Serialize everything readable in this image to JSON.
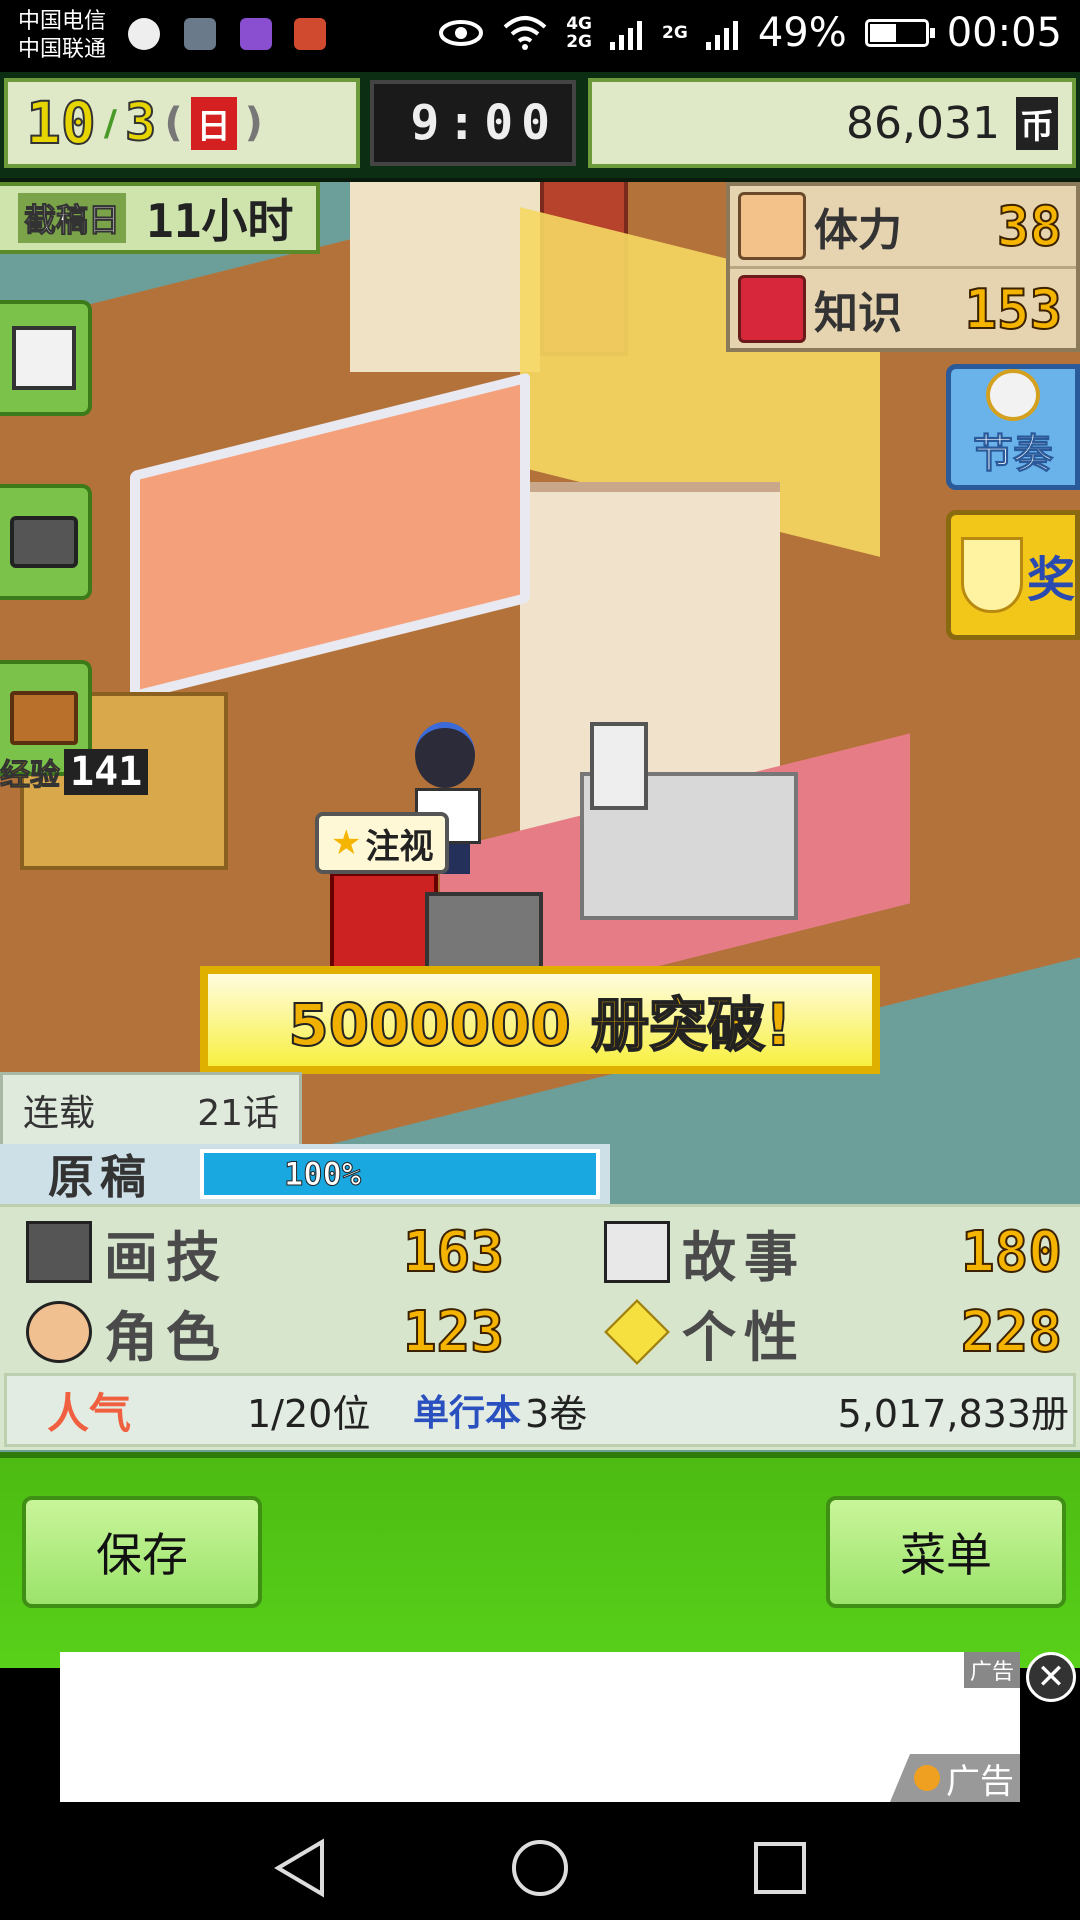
{
  "status_bar": {
    "carrier_1": "中国电信",
    "carrier_2": "中国联通",
    "network_1": "4G",
    "network_2": "2G",
    "network_3": "2G",
    "battery": "49%",
    "battery_level": 0.49,
    "time": "00:05"
  },
  "top_bar": {
    "month": "10",
    "week": "3",
    "day": "日",
    "clock": "9:00",
    "money": "86,031",
    "money_icon": "币"
  },
  "deadline": {
    "label": "截稿日",
    "value": "11小时"
  },
  "stats_right": {
    "stamina_label": "体力",
    "stamina_value": "38",
    "knowledge_label": "知识",
    "knowledge_value": "153"
  },
  "side_buttons": {
    "rhythm_label": "节奏",
    "award_label": "奖"
  },
  "left_badge": {
    "label": "经验",
    "value": "141"
  },
  "character": {
    "tag": "注视"
  },
  "banner": {
    "text": "5000000 册突破!"
  },
  "serial": {
    "label": "连载",
    "value": "21话"
  },
  "manuscript": {
    "label": "原稿",
    "progress_text": "100%",
    "progress": 1.0
  },
  "stats": {
    "drawing_label": "画技",
    "drawing_value": "163",
    "story_label": "故事",
    "story_value": "180",
    "character_label": "角色",
    "character_value": "123",
    "personality_label": "个性",
    "personality_value": "228"
  },
  "popularity": {
    "label": "人气",
    "rank": "1/20位",
    "volumes_label": "单行本",
    "volumes": "3卷",
    "copies": "5,017,833册"
  },
  "bottom_bar": {
    "save_label": "保存",
    "menu_label": "菜单"
  },
  "ad": {
    "tag": "广告",
    "badge": "广告"
  },
  "icons": {
    "eye": "eye-icon",
    "wifi": "wifi-icon",
    "signal": "signal-icon",
    "back": "back-nav-icon",
    "home": "home-nav-icon",
    "recent": "recent-nav-icon"
  },
  "colors": {
    "accent_green": "#58d11a",
    "gold": "#f5b400",
    "progress_blue": "#1aa8e0"
  }
}
